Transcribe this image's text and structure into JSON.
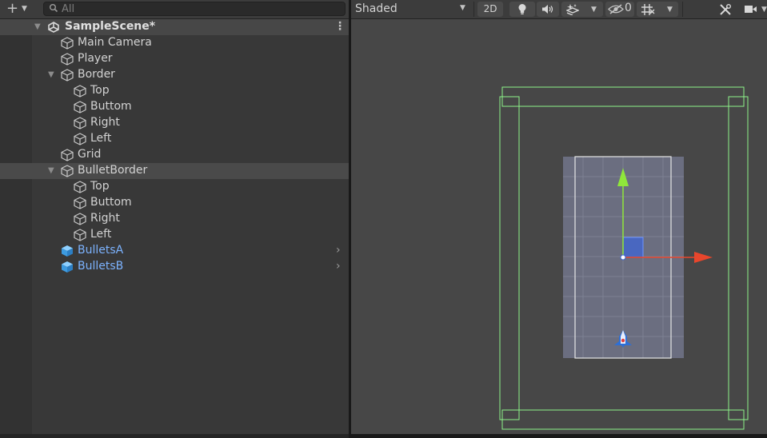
{
  "hierarchy": {
    "search_placeholder": "All",
    "scene_name": "SampleScene*",
    "items": [
      {
        "label": "Main Camera"
      },
      {
        "label": "Player"
      },
      {
        "label": "Border"
      },
      {
        "label": "Top"
      },
      {
        "label": "Buttom"
      },
      {
        "label": "Right"
      },
      {
        "label": "Left"
      },
      {
        "label": "Grid"
      },
      {
        "label": "BulletBorder"
      },
      {
        "label": "Top"
      },
      {
        "label": "Buttom"
      },
      {
        "label": "Right"
      },
      {
        "label": "Left"
      },
      {
        "label": "BulletsA"
      },
      {
        "label": "BulletsB"
      }
    ]
  },
  "scene_toolbar": {
    "shading_mode": "Shaded",
    "mode_2d_label": "2D",
    "hidden_objects_count": "0"
  },
  "colors": {
    "panel_bg": "#383838",
    "selection_bg": "#4a4a4a",
    "prefab_text": "#7cb3ff",
    "collider_green": "#8ef38a",
    "axis_x": "#e8462c",
    "axis_y": "#8fe63a"
  },
  "icons": {
    "add": "plus-icon",
    "search": "search-icon",
    "scene": "unity-scene-icon",
    "gameobject": "cube-icon",
    "prefab": "prefab-cube-icon",
    "lighting": "lightbulb-icon",
    "audio": "speaker-icon",
    "effects": "effects-icon",
    "visibility": "eye-slash-icon",
    "grid": "grid-icon",
    "tools": "tools-icon",
    "camera": "camera-icon"
  }
}
